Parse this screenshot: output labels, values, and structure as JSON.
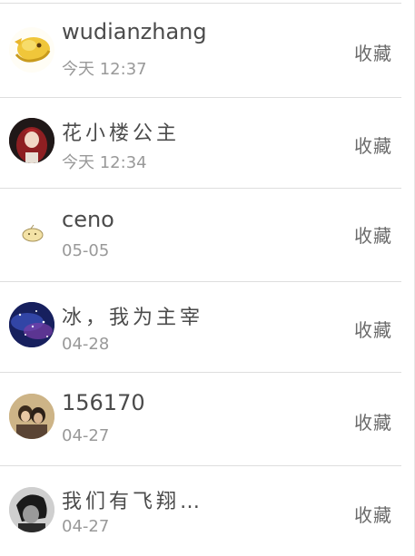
{
  "records": [
    {
      "name": "wudianzhang",
      "time": "今天 12:37",
      "action": "收藏",
      "avatar": "yellow-dragon-avatar"
    },
    {
      "name": "花小楼公主",
      "time": "今天 12:34",
      "action": "收藏",
      "avatar": "red-hair-girl-avatar"
    },
    {
      "name": "ceno",
      "time": "05-05",
      "action": "收藏",
      "avatar": "small-cartoon-avatar"
    },
    {
      "name": "冰，我为主宰",
      "time": "04-28",
      "action": "收藏",
      "avatar": "galaxy-avatar"
    },
    {
      "name": "156170",
      "time": "04-27",
      "action": "收藏",
      "avatar": "couple-photo-avatar"
    },
    {
      "name": "我们有飞翔…",
      "time": "04-27",
      "action": "收藏",
      "avatar": "black-white-portrait-avatar"
    }
  ]
}
